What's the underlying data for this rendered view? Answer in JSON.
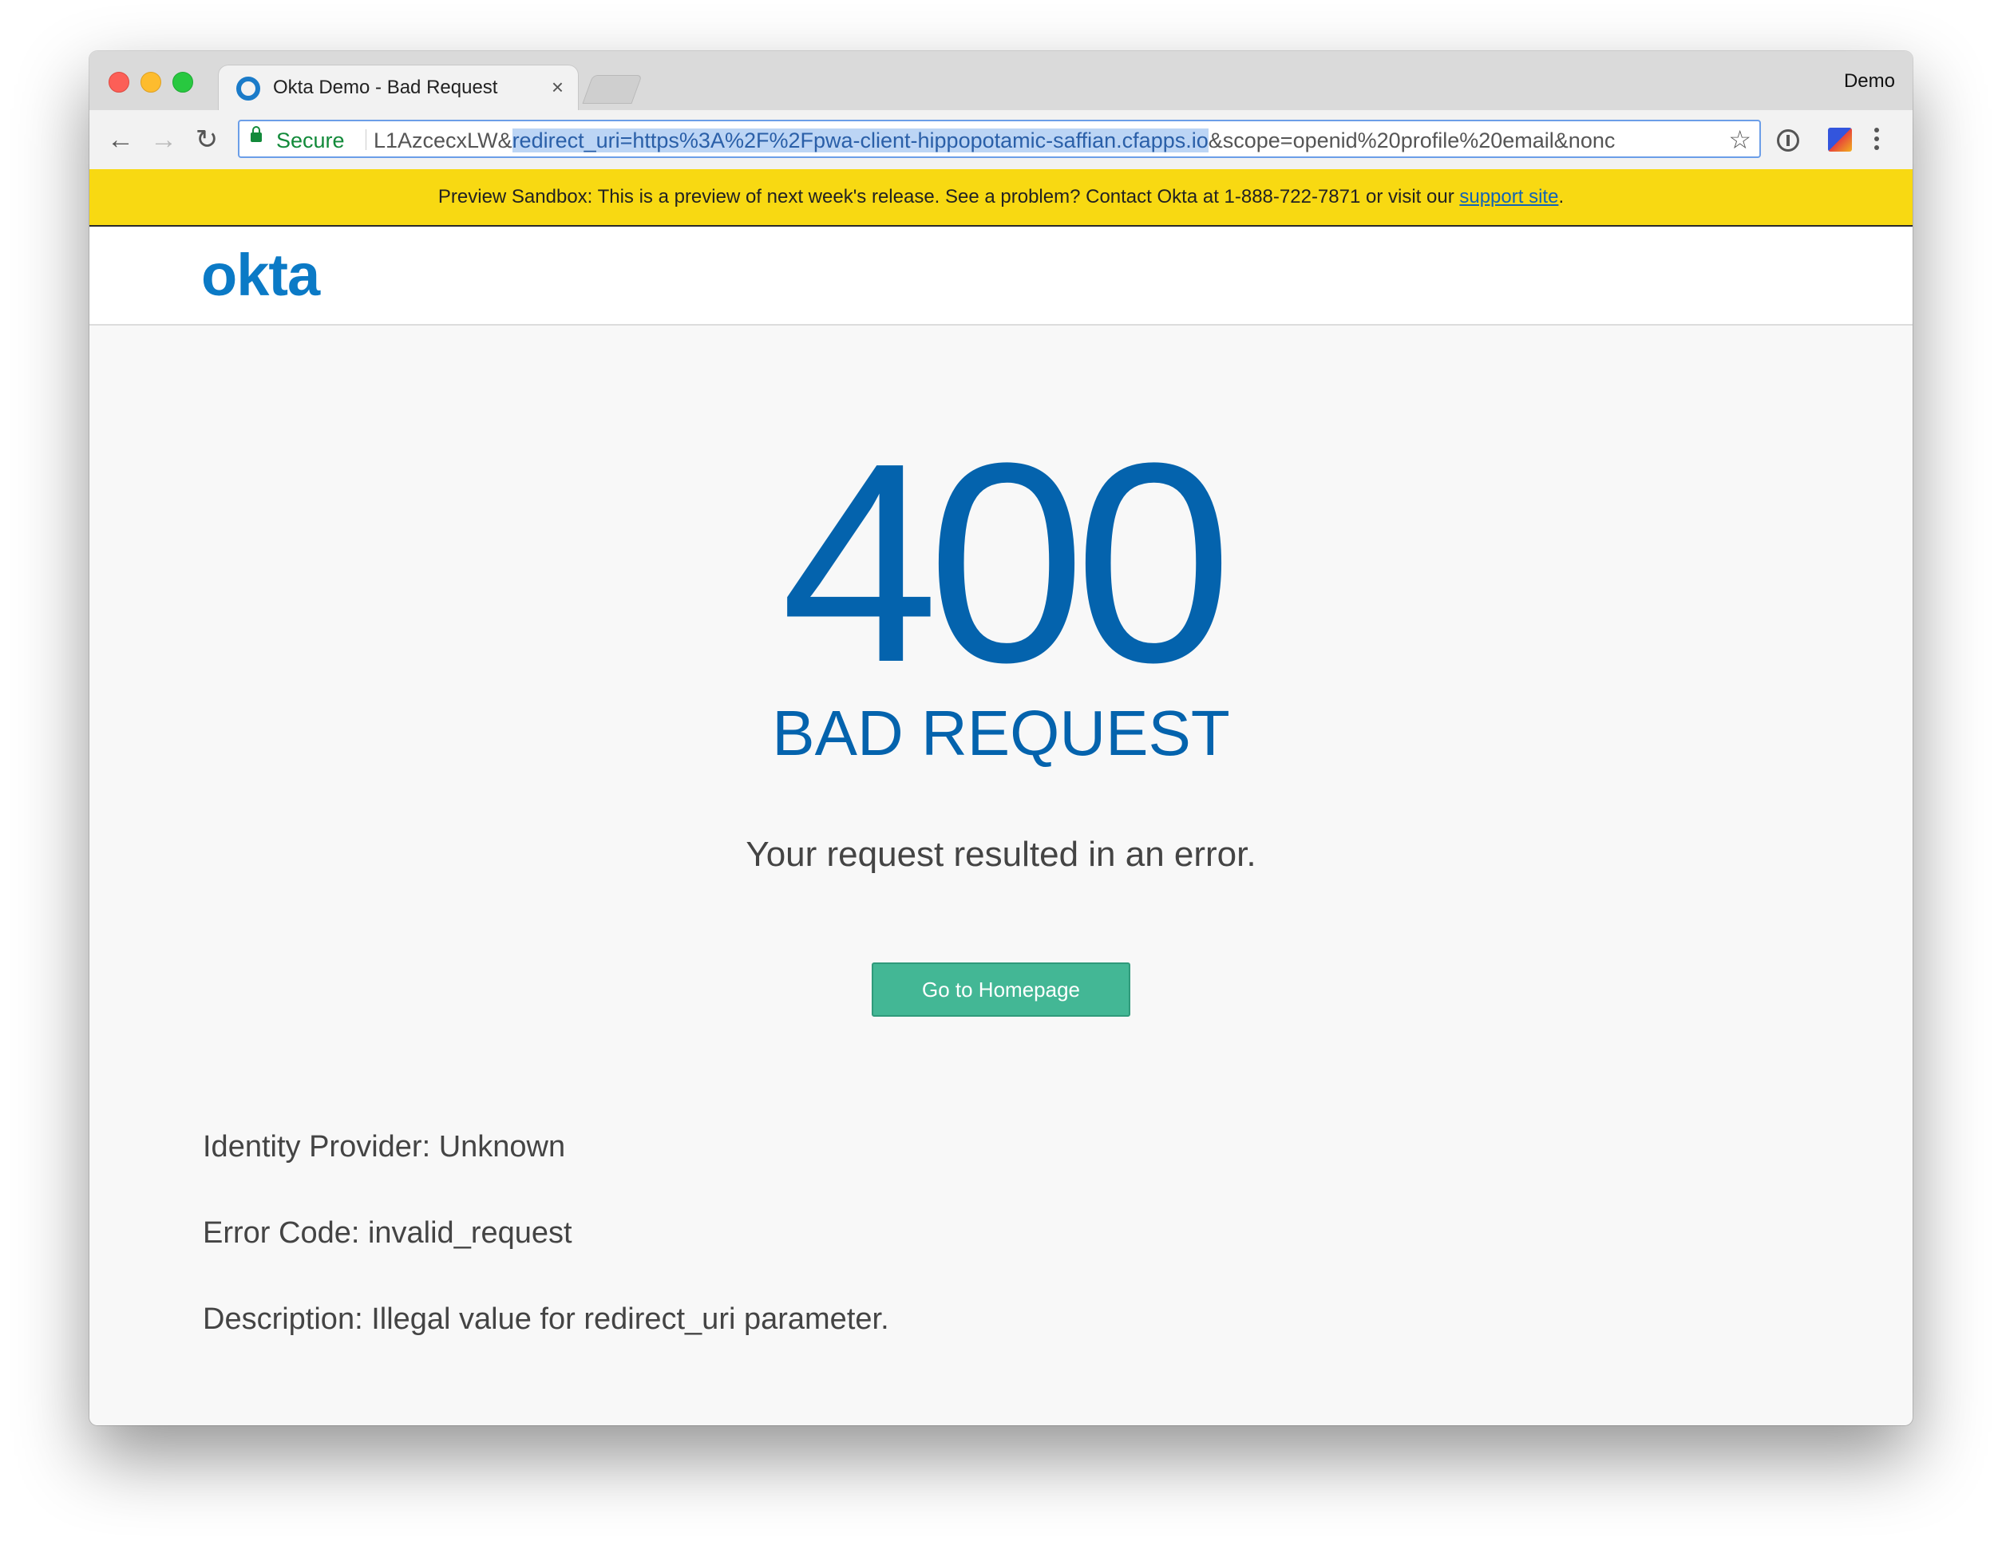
{
  "browser": {
    "tab_title": "Okta Demo - Bad Request",
    "tab_close": "×",
    "profile_name": "Demo",
    "secure_label": "Secure",
    "url_prefix": "L1AzcecxLW&",
    "url_selected": "redirect_uri=https%3A%2F%2Fpwa-client-hippopotamic-saffian.cfapps.io",
    "url_suffix": "&scope=openid%20profile%20email&nonc",
    "back_glyph": "←",
    "forward_glyph": "→",
    "reload_glyph": "↻",
    "star_glyph": "☆"
  },
  "banner": {
    "text": "Preview Sandbox: This is a preview of next week's release. See a problem? Contact Okta at 1-888-722-7871 or visit our ",
    "link_text": "support site",
    "end": "."
  },
  "header": {
    "logo_text": "okta"
  },
  "error": {
    "code": "400",
    "title": "BAD REQUEST",
    "message": "Your request resulted in an error.",
    "button_label": "Go to Homepage",
    "identity_provider": "Identity Provider: Unknown",
    "error_code": "Error Code: invalid_request",
    "description": "Description: Illegal value for redirect_uri parameter."
  },
  "colors": {
    "banner": "#f8d912",
    "brand_blue": "#0463ad",
    "button_green": "#43b795"
  }
}
